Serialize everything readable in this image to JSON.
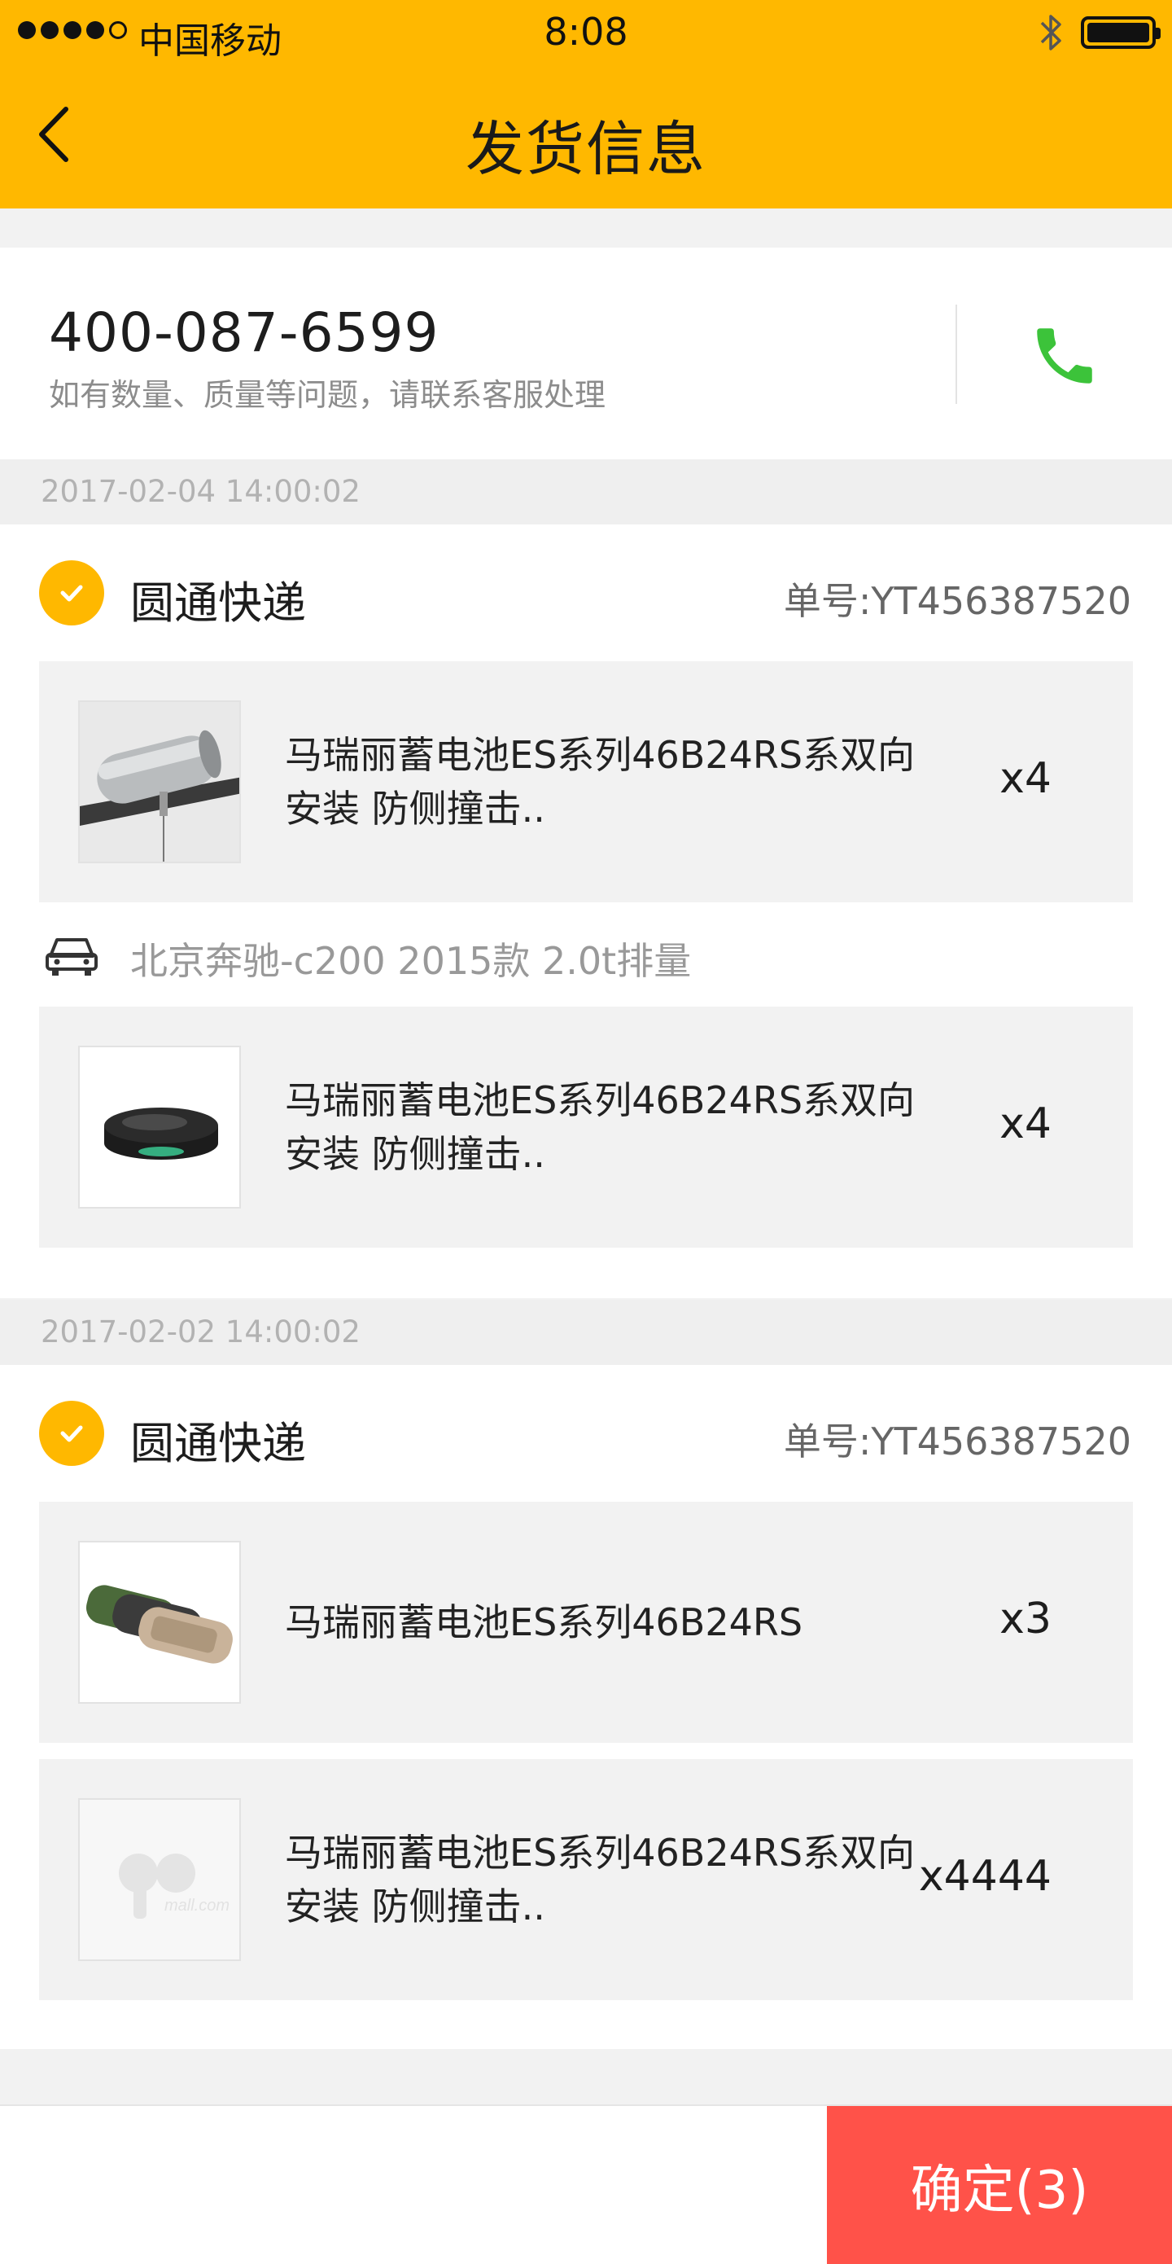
{
  "status_bar": {
    "carrier": "中国移动",
    "time": "8:08"
  },
  "header": {
    "title": "发货信息"
  },
  "contact": {
    "phone": "400-087-6599",
    "hint": "如有数量、质量等问题，请联系客服处理"
  },
  "shipments": [
    {
      "date": "2017-02-04 14:00:02",
      "carrier": "圆通快递",
      "tracking": "单号:YT456387520",
      "items": [
        {
          "name": "马瑞丽蓄电池ES系列46B24RS系双向安装 防侧撞击..",
          "qty": "x4",
          "image": "camera-product"
        },
        {
          "name": "马瑞丽蓄电池ES系列46B24RS系双向安装 防侧撞击..",
          "qty": "x4",
          "image": "router-product"
        }
      ],
      "vehicle": "北京奔驰-c200 2015款 2.0t排量"
    },
    {
      "date": "2017-02-02 14:00:02",
      "carrier": "圆通快递",
      "tracking": "单号:YT456387520",
      "items": [
        {
          "name": "马瑞丽蓄电池ES系列46B24RS",
          "qty": "x3",
          "image": "speaker-product"
        },
        {
          "name": "马瑞丽蓄电池ES系列46B24RS系双向安装 防侧撞击..",
          "qty": "x4444",
          "image": "placeholder-logo"
        }
      ]
    }
  ],
  "placeholder_logo": {
    "text": "mall.com"
  },
  "footer": {
    "confirm_label": "确定(3)"
  },
  "colors": {
    "accent": "#ffb800",
    "confirm": "#ff5249",
    "call": "#3cc33a"
  }
}
